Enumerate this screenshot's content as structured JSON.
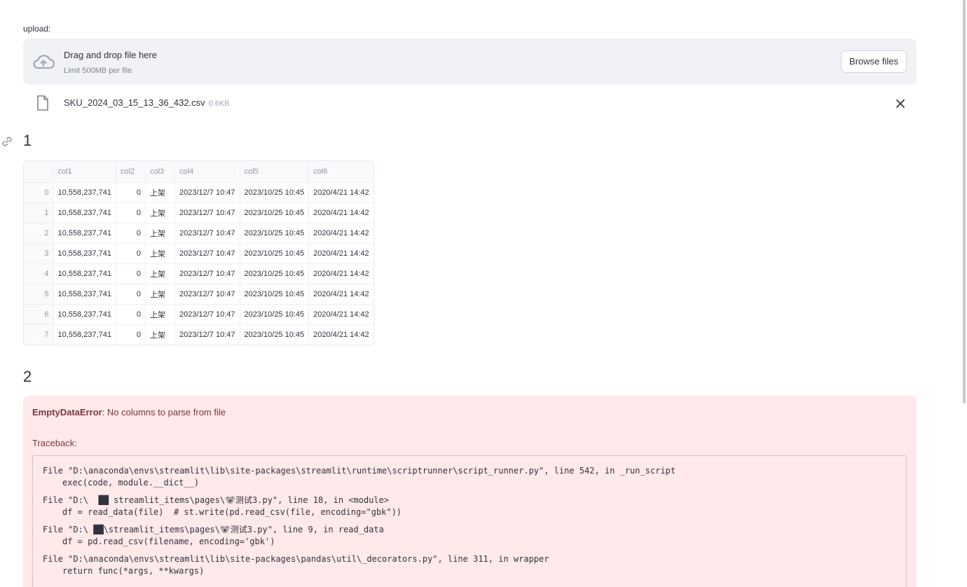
{
  "uploader": {
    "label": "upload:",
    "drop_title": "Drag and drop file here",
    "limit_text": "Limit 500MB per file",
    "browse_label": "Browse files"
  },
  "uploaded_file": {
    "name": "SKU_2024_03_15_13_36_432.csv",
    "size": "0.6KB"
  },
  "section1_title": "1",
  "table": {
    "columns": [
      "",
      "col1",
      "col2",
      "col3",
      "col4",
      "col5",
      "col6"
    ],
    "rows": [
      [
        "0",
        "10,558,237,741",
        "0",
        "上架",
        "2023/12/7 10:47",
        "2023/10/25 10:45",
        "2020/4/21 14:42"
      ],
      [
        "1",
        "10,558,237,741",
        "0",
        "上架",
        "2023/12/7 10:47",
        "2023/10/25 10:45",
        "2020/4/21 14:42"
      ],
      [
        "2",
        "10,558,237,741",
        "0",
        "上架",
        "2023/12/7 10:47",
        "2023/10/25 10:45",
        "2020/4/21 14:42"
      ],
      [
        "3",
        "10,558,237,741",
        "0",
        "上架",
        "2023/12/7 10:47",
        "2023/10/25 10:45",
        "2020/4/21 14:42"
      ],
      [
        "4",
        "10,558,237,741",
        "0",
        "上架",
        "2023/12/7 10:47",
        "2023/10/25 10:45",
        "2020/4/21 14:42"
      ],
      [
        "5",
        "10,558,237,741",
        "0",
        "上架",
        "2023/12/7 10:47",
        "2023/10/25 10:45",
        "2020/4/21 14:42"
      ],
      [
        "6",
        "10,558,237,741",
        "0",
        "上架",
        "2023/12/7 10:47",
        "2023/10/25 10:45",
        "2020/4/21 14:42"
      ],
      [
        "7",
        "10,558,237,741",
        "0",
        "上架",
        "2023/12/7 10:47",
        "2023/10/25 10:45",
        "2020/4/21 14:42"
      ]
    ]
  },
  "section2_title": "2",
  "error": {
    "type": "EmptyDataError",
    "message": ": No columns to parse from file",
    "traceback_label": "Traceback:",
    "frames": [
      {
        "loc": "File \"D:\\anaconda\\envs\\streamlit\\lib\\site-packages\\streamlit\\runtime\\scriptrunner\\script_runner.py\", line 542, in _run_script",
        "code": "exec(code, module.__dict__)"
      },
      {
        "loc": "File \"D:\\  ██ streamlit_items\\pages\\🐨测试3.py\", line 18, in <module>",
        "code": "df = read_data(file)  # st.write(pd.read_csv(file, encoding=\"gbk\"))"
      },
      {
        "loc": "File \"D:\\ ██\\streamlit_items\\pages\\🐨测试3.py\", line 9, in read_data",
        "code": "df = pd.read_csv(filename, encoding='gbk')"
      },
      {
        "loc": "File \"D:\\anaconda\\envs\\streamlit\\lib\\site-packages\\pandas\\util\\_decorators.py\", line 311, in wrapper",
        "code": "return func(*args, **kwargs)"
      }
    ]
  },
  "icons": {
    "upload": "cloud-upload-icon",
    "file": "file-icon",
    "close": "close-icon",
    "anchor": "link-icon"
  },
  "colors": {
    "dropzone_bg": "#f0f2f6",
    "error_bg": "#ffe9ea",
    "error_text": "#7d353b"
  }
}
